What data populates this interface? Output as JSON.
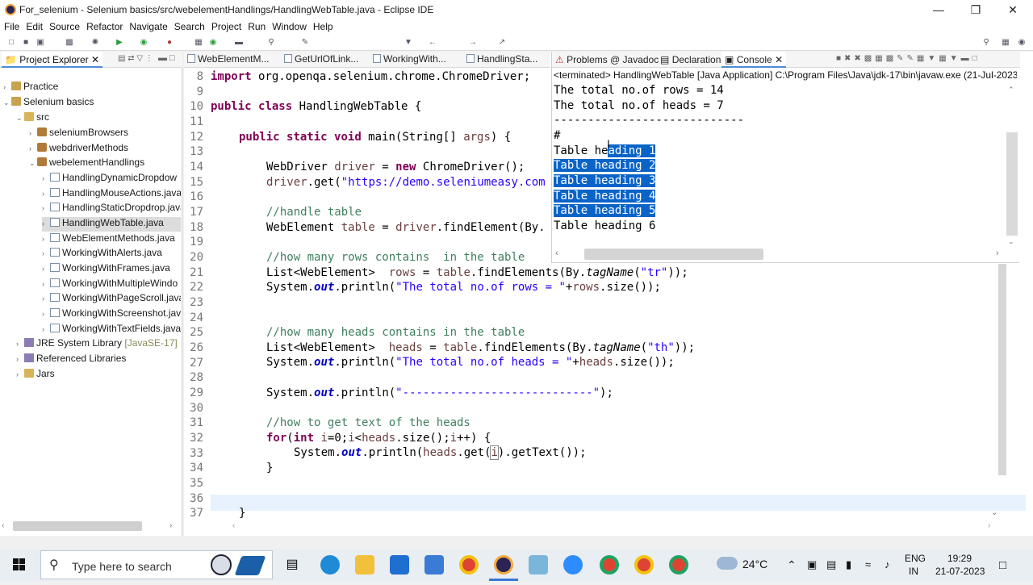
{
  "window": {
    "title": "For_selenium - Selenium basics/src/webelementHandlings/HandlingWebTable.java - Eclipse IDE"
  },
  "menu": [
    "File",
    "Edit",
    "Source",
    "Refactor",
    "Navigate",
    "Search",
    "Project",
    "Run",
    "Window",
    "Help"
  ],
  "explorer": {
    "tab_label": "Project Explorer",
    "tree": [
      {
        "label": "Practice",
        "level": 0,
        "icon": "project-icon"
      },
      {
        "label": "Selenium basics",
        "level": 0,
        "icon": "project-icon"
      },
      {
        "label": "src",
        "level": 1,
        "icon": "folder-icon"
      },
      {
        "label": "seleniumBrowsers",
        "level": 2,
        "icon": "package-icon"
      },
      {
        "label": "webdriverMethods",
        "level": 2,
        "icon": "package-icon"
      },
      {
        "label": "webelementHandlings",
        "level": 2,
        "icon": "package-icon"
      },
      {
        "label": "HandlingDynamicDropdow",
        "level": 3,
        "icon": "java-file-icon"
      },
      {
        "label": "HandlingMouseActions.java",
        "level": 3,
        "icon": "java-file-icon"
      },
      {
        "label": "HandlingStaticDropdrop.java",
        "level": 3,
        "icon": "java-file-icon"
      },
      {
        "label": "HandlingWebTable.java",
        "level": 3,
        "icon": "java-file-icon"
      },
      {
        "label": "WebElementMethods.java",
        "level": 3,
        "icon": "java-file-icon"
      },
      {
        "label": "WorkingWithAlerts.java",
        "level": 3,
        "icon": "java-file-icon"
      },
      {
        "label": "WorkingWithFrames.java",
        "level": 3,
        "icon": "java-file-icon"
      },
      {
        "label": "WorkingWithMultipleWindo",
        "level": 3,
        "icon": "java-file-icon"
      },
      {
        "label": "WorkingWithPageScroll.java",
        "level": 3,
        "icon": "java-file-icon"
      },
      {
        "label": "WorkingWithScreenshot.java",
        "level": 3,
        "icon": "java-file-icon"
      },
      {
        "label": "WorkingWithTextFields.java",
        "level": 3,
        "icon": "java-file-icon"
      },
      {
        "label": "JRE System Library",
        "level": 1,
        "icon": "library-icon"
      },
      {
        "label": "Referenced Libraries",
        "level": 1,
        "icon": "library-icon"
      },
      {
        "label": "Jars",
        "level": 1,
        "icon": "folder-icon"
      }
    ],
    "jre_version": "[JavaSE-17]"
  },
  "editor": {
    "tabs": [
      "WebElementM...",
      "GetUrlOfLink...",
      "WorkingWith...",
      "HandlingSta..."
    ],
    "line_numbers": [
      "8",
      "9",
      "10",
      "11",
      "12",
      "13",
      "14",
      "15",
      "16",
      "17",
      "18",
      "19",
      "20",
      "21",
      "22",
      "23",
      "24",
      "25",
      "26",
      "27",
      "28",
      "29",
      "30",
      "31",
      "32",
      "33",
      "34",
      "35",
      "36",
      "37"
    ],
    "code": {
      "l8a": "import",
      "l8b": " org.openqa.selenium.chrome.ChromeDriver;",
      "l10a": "public",
      "l10b": "class",
      "l10c": " HandlingWebTable {",
      "l12a": "public",
      "l12b": "static",
      "l12c": "void",
      "l12d": " main(String[] ",
      "l12e": "args",
      "l12f": ") {",
      "l14a": "WebDriver ",
      "l14b": "driver",
      "l14c": " = ",
      "l14d": "new",
      "l14e": " ChromeDriver();",
      "l15a": "driver",
      "l15b": ".get(",
      "l15c": "\"https://demo.seleniumeasy.com",
      "l17": "//handle table",
      "l18a": "WebElement ",
      "l18b": "table",
      "l18c": " = ",
      "l18d": "driver",
      "l18e": ".findElement(By.",
      "l20": "//how many rows contains  in the table",
      "l21a": "List<WebElement>  ",
      "l21b": "rows",
      "l21c": " = ",
      "l21d": "table",
      "l21e": ".findElements(By.",
      "l21f": "tagName",
      "l21g": "(",
      "l21h": "\"tr\"",
      "l21i": "));",
      "l22a": "System.",
      "l22b": "out",
      "l22c": ".println(",
      "l22d": "\"The total no.of rows = \"",
      "l22e": "+",
      "l22f": "rows",
      "l22g": ".size());",
      "l25": "//how many heads contains in the table",
      "l26a": "List<WebElement>  ",
      "l26b": "heads",
      "l26c": " = ",
      "l26d": "table",
      "l26e": ".findElements(By.",
      "l26f": "tagName",
      "l26g": "(",
      "l26h": "\"th\"",
      "l26i": "));",
      "l27a": "System.",
      "l27b": "out",
      "l27c": ".println(",
      "l27d": "\"The total no.of heads = \"",
      "l27e": "+",
      "l27f": "heads",
      "l27g": ".size());",
      "l29a": "System.",
      "l29b": "out",
      "l29c": ".println(",
      "l29d": "\"----------------------------\"",
      "l29e": ");",
      "l31": "//how to get text of the heads",
      "l32a": "for",
      "l32b": "(",
      "l32c": "int",
      "l32d": " ",
      "l32e": "i",
      "l32f": "=0;",
      "l32g": "i",
      "l32h": "<",
      "l32i": "heads",
      "l32j": ".size();",
      "l32k": "i",
      "l32l": "++) {",
      "l33a": "System.",
      "l33b": "out",
      "l33c": ".println(",
      "l33d": "heads",
      "l33e": ".get(",
      "l33f": "i",
      "l33g": ").getText());",
      "l34": "}",
      "l37": "}"
    }
  },
  "console": {
    "tabs": [
      "Problems",
      "Javadoc",
      "Declaration",
      "Console"
    ],
    "status": "<terminated> HandlingWebTable [Java Application] C:\\Program Files\\Java\\jdk-17\\bin\\javaw.exe  (21-Jul-2023,",
    "lines": [
      "The total no.of rows = 14",
      "The total no.of heads = 7",
      "----------------------------",
      "#"
    ],
    "heading_prefix": "Table he",
    "heading1_rest": "ading 1",
    "headings_selected": [
      "Table heading 2",
      "Table heading 3",
      "Table heading 4",
      "Table heading 5"
    ],
    "heading6": "Table heading 6"
  },
  "taskbar": {
    "search_placeholder": "Type here to search",
    "weather": "24°C",
    "lang1": "ENG",
    "lang2": "IN",
    "time": "19:29",
    "date": "21-07-2023"
  },
  "colors": {
    "selection": "#0a64c8",
    "keyword": "#7f0055",
    "comment": "#3f7f5f",
    "string": "#2a00ff",
    "field": "#0000c0"
  }
}
